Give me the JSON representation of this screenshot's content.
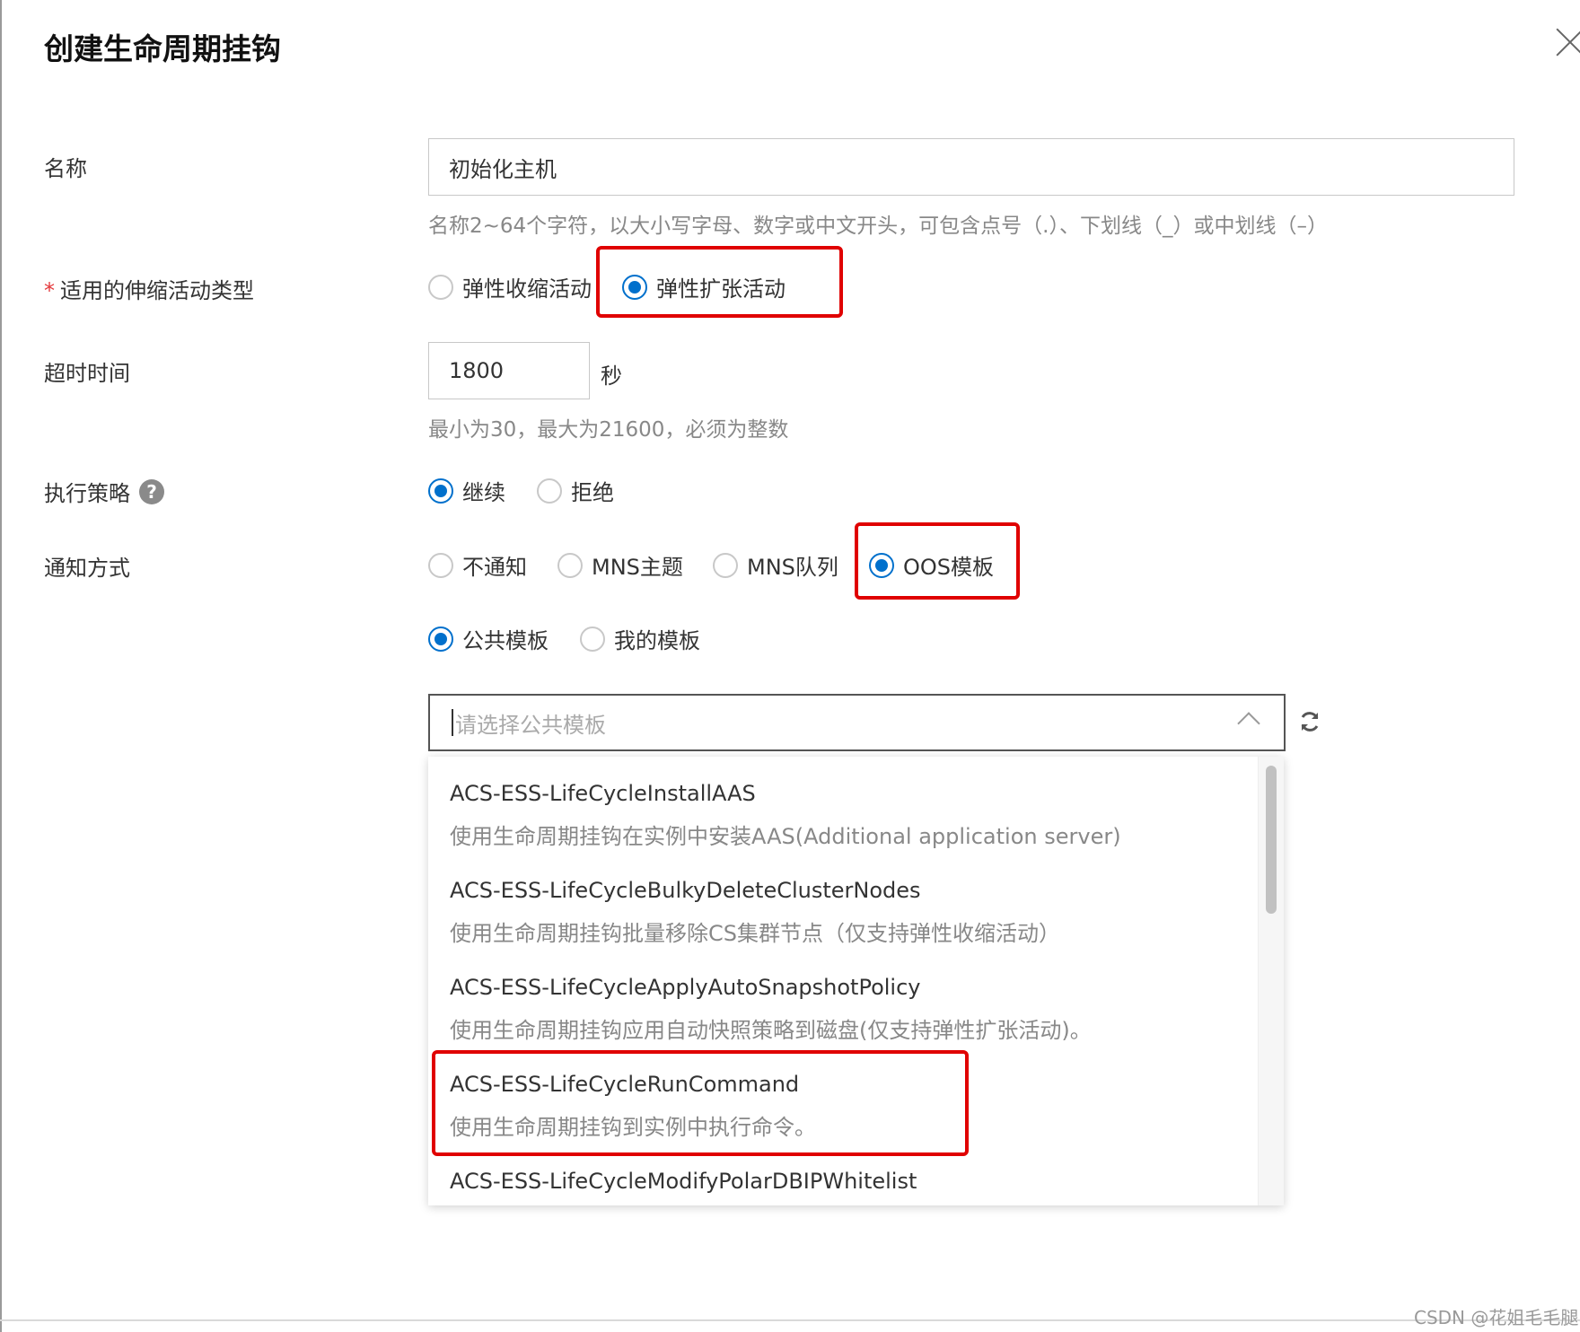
{
  "dialog": {
    "title": "创建生命周期挂钩",
    "close_label": "×"
  },
  "form": {
    "name": {
      "label": "名称",
      "value": "初始化主机",
      "hint": "名称2~64个字符，以大小写字母、数字或中文开头，可包含点号（.）、下划线（_）或中划线（–）"
    },
    "activity_type": {
      "required_mark": "*",
      "label": "适用的伸缩活动类型",
      "options": [
        "弹性收缩活动",
        "弹性扩张活动"
      ],
      "selected": "弹性扩张活动"
    },
    "timeout": {
      "label": "超时时间",
      "value": "1800",
      "unit": "秒",
      "hint": "最小为30，最大为21600，必须为整数"
    },
    "policy": {
      "label": "执行策略",
      "help": "?",
      "options": [
        "继续",
        "拒绝"
      ],
      "selected": "继续"
    },
    "notify": {
      "label": "通知方式",
      "options": [
        "不通知",
        "MNS主题",
        "MNS队列",
        "OOS模板"
      ],
      "selected": "OOS模板"
    },
    "template_source": {
      "options": [
        "公共模板",
        "我的模板"
      ],
      "selected": "公共模板"
    },
    "template_select": {
      "placeholder": "请选择公共模板"
    },
    "dropdown_items": [
      {
        "name": "ACS-ESS-LifeCycleInstallAAS",
        "desc": "使用生命周期挂钩在实例中安装AAS(Additional application server)"
      },
      {
        "name": "ACS-ESS-LifeCycleBulkyDeleteClusterNodes",
        "desc": "使用生命周期挂钩批量移除CS集群节点（仅支持弹性收缩活动）"
      },
      {
        "name": "ACS-ESS-LifeCycleApplyAutoSnapshotPolicy",
        "desc": "使用生命周期挂钩应用自动快照策略到磁盘(仅支持弹性扩张活动)。"
      },
      {
        "name": "ACS-ESS-LifeCycleRunCommand",
        "desc": "使用生命周期挂钩到实例中执行命令。"
      },
      {
        "name": "ACS-ESS-LifeCycleModifyPolarDBIPWhitelist",
        "desc": ""
      }
    ]
  },
  "watermark": "CSDN @花姐毛毛腿",
  "colors": {
    "accent": "#0070cc",
    "highlight": "#e00000"
  }
}
